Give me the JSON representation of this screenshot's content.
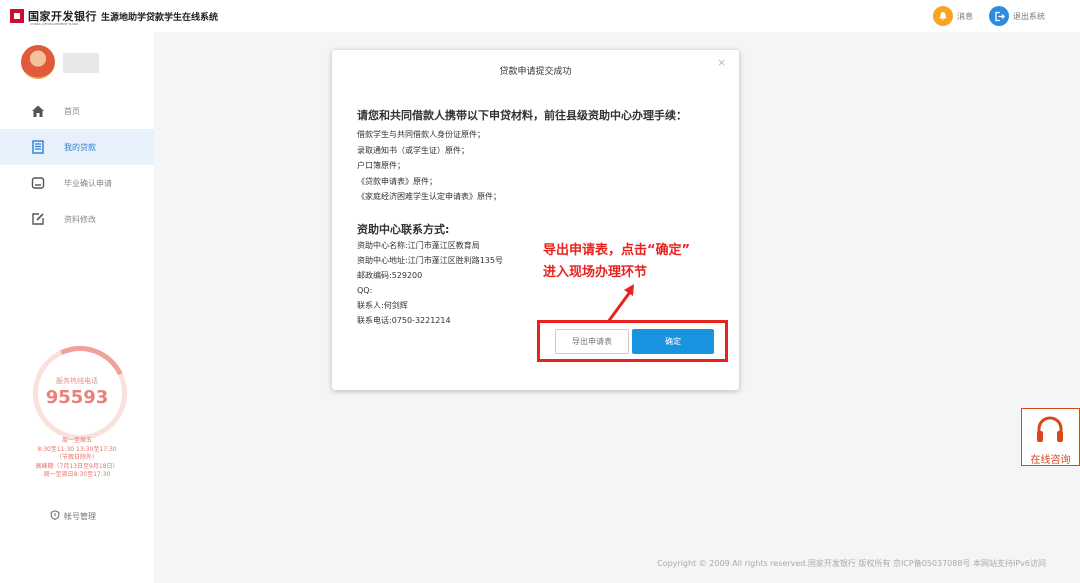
{
  "header": {
    "bank_name": "国家开发银行",
    "bank_name_en": "CHINA DEVELOPMENT BANK",
    "system_title": "生源地助学贷款学生在线系统",
    "messages_label": "消息",
    "logout_label": "退出系统"
  },
  "sidebar": {
    "items": [
      {
        "label": "首页",
        "icon": "home-icon"
      },
      {
        "label": "我的贷款",
        "icon": "document-icon"
      },
      {
        "label": "毕业确认申请",
        "icon": "graduation-icon"
      },
      {
        "label": "资料修改",
        "icon": "edit-icon"
      }
    ],
    "hotline_label": "服务热线电话",
    "hotline_number": "95593",
    "hours": [
      "周一至周五",
      "8:30至11:30 13:30至17:30",
      "（节假日除外）",
      "高峰期（7月13日至9月18日）",
      "周一至周日8:30至17:30"
    ],
    "account_label": "帐号管理"
  },
  "modal": {
    "title": "贷款申请提交成功",
    "close": "×",
    "materials_heading": "请您和共同借款人携带以下申贷材料，前往县级资助中心办理手续：",
    "materials": [
      "借款学生与共同借款人身份证原件；",
      "录取通知书（或学生证）原件；",
      "户口簿原件；",
      "《贷款申请表》原件；",
      "《家庭经济困难学生认定申请表》原件；"
    ],
    "contact_heading": "资助中心联系方式:",
    "contact": [
      "资助中心名称:江门市蓬江区教育局",
      "资助中心地址:江门市蓬江区胜利路135号",
      "邮政编码:529200",
      "QQ:",
      "联系人:何剑辉",
      "联系电话:0750-3221214"
    ],
    "export_label": "导出申请表",
    "confirm_label": "确定"
  },
  "annotation": {
    "line1": "导出申请表，点击“确定”",
    "line2": "进入现场办理环节"
  },
  "online_consult": {
    "label": "在线咨询"
  },
  "footer": {
    "copyright": "Copyright © 2009 All rights reserved.国家开发银行 版权所有 京ICP备05037088号 本网站支持IPv6访问"
  },
  "colors": {
    "accent": "#1a93e0",
    "annotation": "#e8231f",
    "hotline": "#e9817a"
  }
}
